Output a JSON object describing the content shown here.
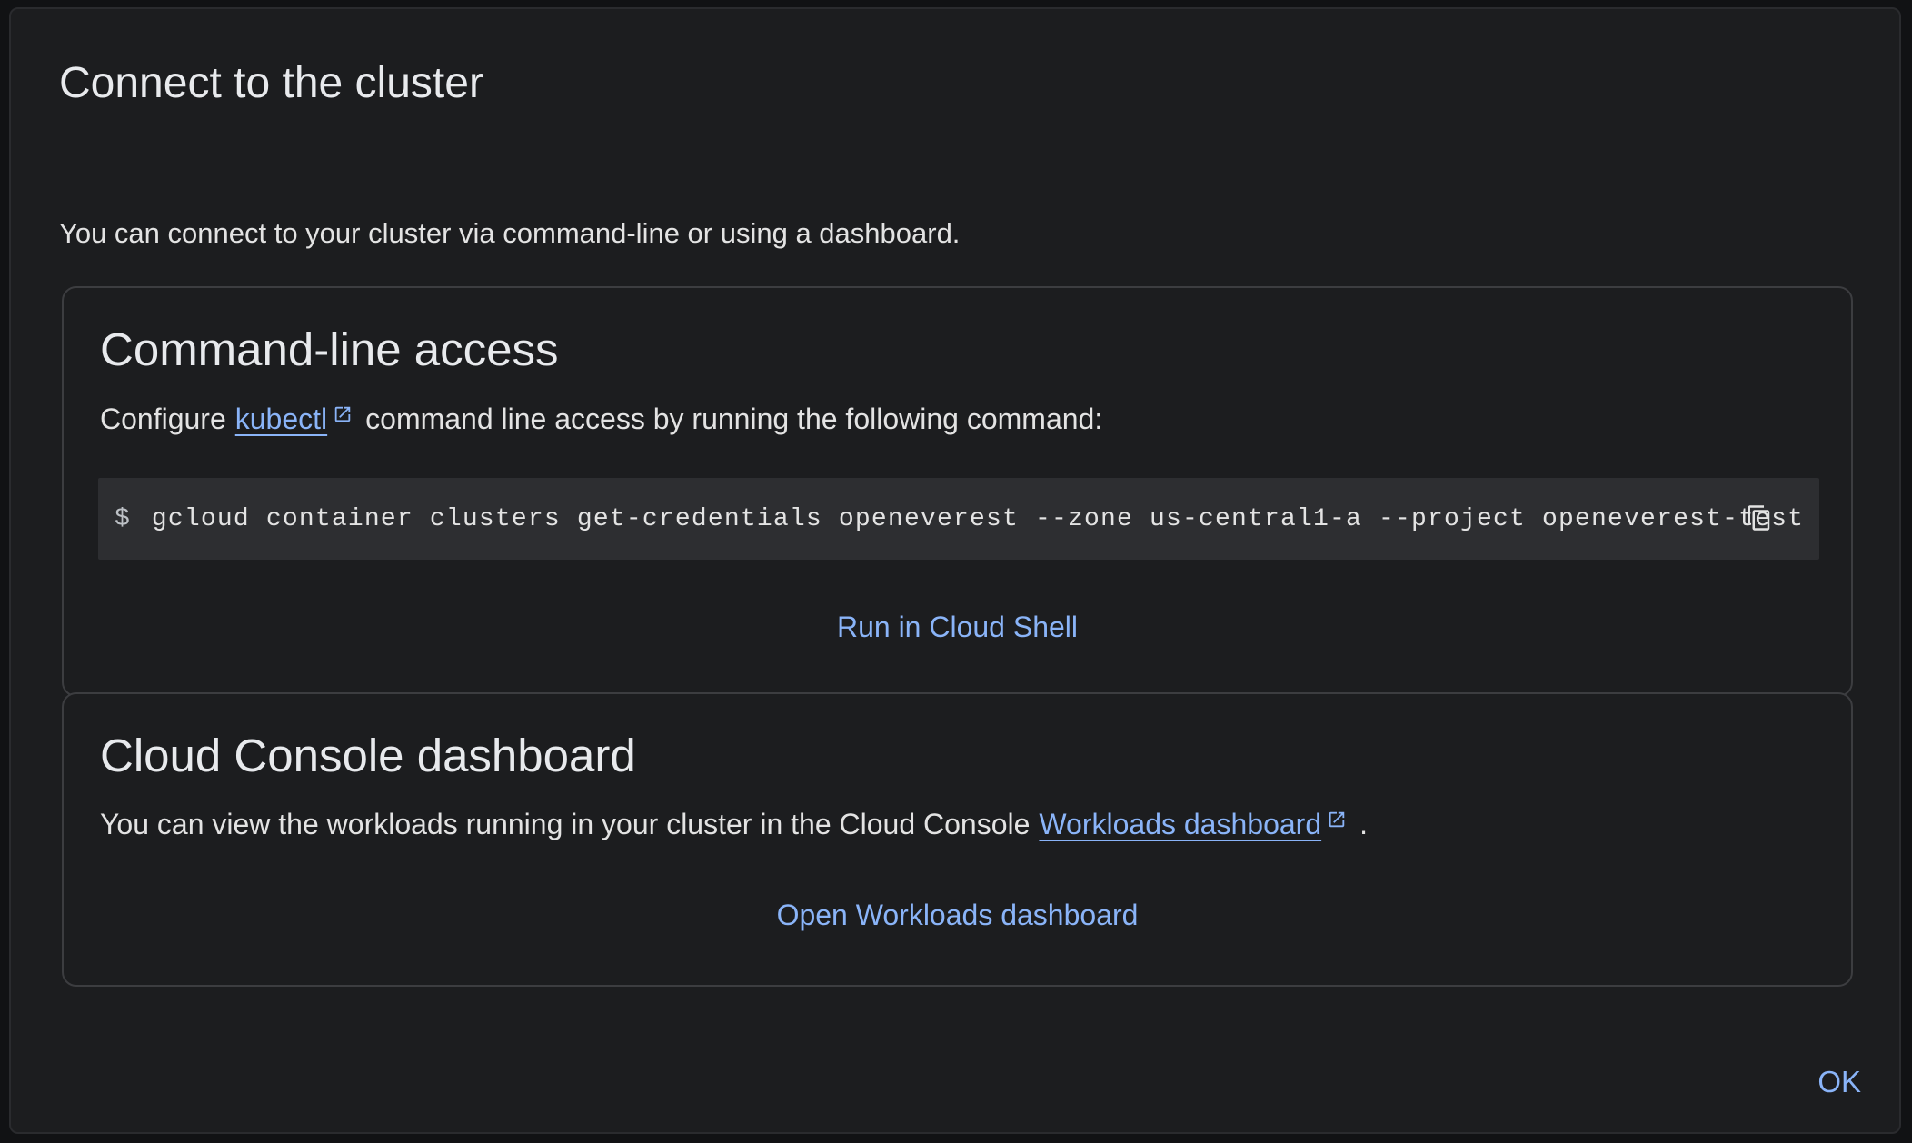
{
  "dialog": {
    "title": "Connect to the cluster",
    "intro": "You can connect to your cluster via command-line or using a dashboard."
  },
  "cli": {
    "title": "Command-line access",
    "text_before": "Configure",
    "link_label": "kubectl",
    "text_after": "command line access by running the following command:",
    "prompt": "$",
    "command": "gcloud container clusters get-credentials openeverest --zone us-central1-a --project openeverest-test",
    "copy_icon": "copy-icon",
    "action_label": "Run in Cloud Shell"
  },
  "console": {
    "title": "Cloud Console dashboard",
    "text_before": "You can view the workloads running in your cluster in the Cloud Console",
    "link_label": "Workloads dashboard",
    "text_after": ".",
    "action_label": "Open Workloads dashboard"
  },
  "footer": {
    "ok_label": "OK"
  },
  "colors": {
    "background": "#1c1d1f",
    "accent": "#8ab4f8",
    "code_bg": "#2d2e31",
    "border": "#3c3d40"
  }
}
